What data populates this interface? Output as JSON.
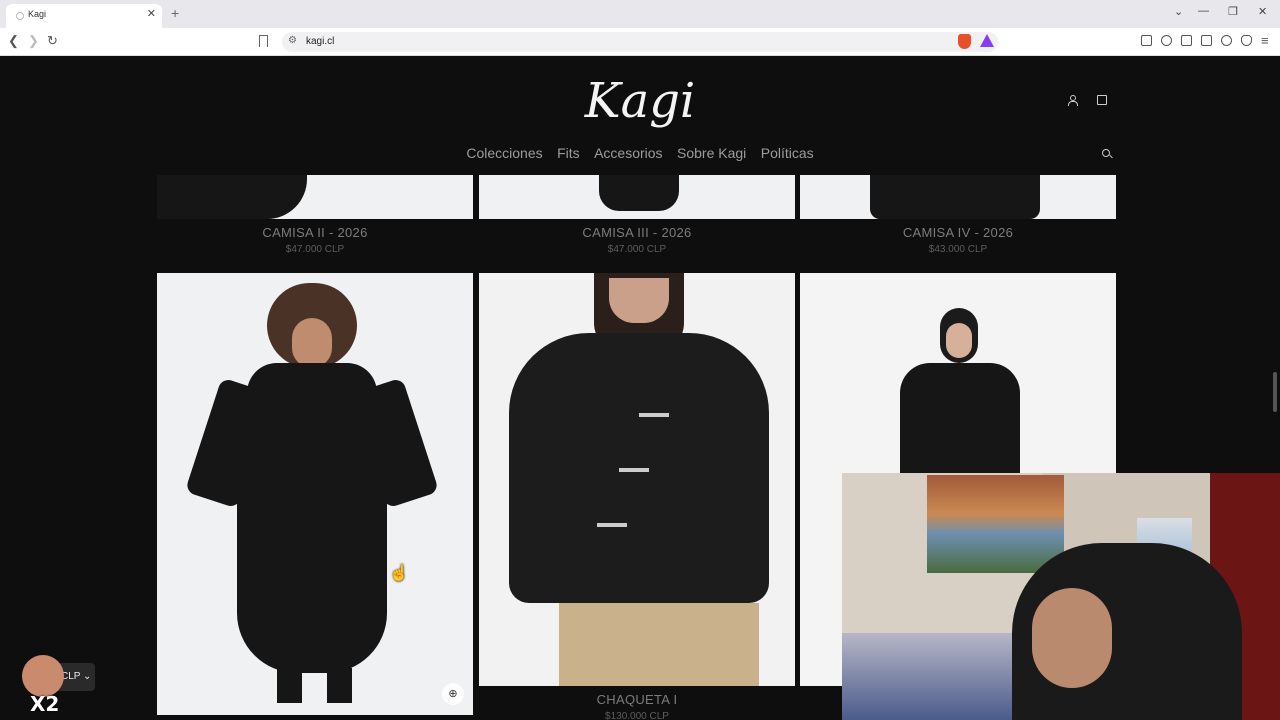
{
  "browser": {
    "tab_title": "Kagi",
    "tab_close": "✕",
    "new_tab": "+",
    "url": "kagi.cl",
    "window_controls": [
      "⌄",
      "—",
      "❐",
      "✕"
    ]
  },
  "site": {
    "logo": "Kagi",
    "nav": [
      "Colecciones",
      "Fits",
      "Accesorios",
      "Sobre Kagi",
      "Políticas"
    ]
  },
  "products": [
    {
      "title": "CAMISA II - 2026",
      "price": "$47.000 CLP"
    },
    {
      "title": "CAMISA III - 2026",
      "price": "$47.000 CLP"
    },
    {
      "title": "CAMISA IV - 2026",
      "price": "$43.000 CLP"
    },
    {
      "title": "CHAQUETA I",
      "price": "$130.000 CLP"
    }
  ],
  "overlay": {
    "currency": "CLP",
    "multiplier": "X2"
  }
}
